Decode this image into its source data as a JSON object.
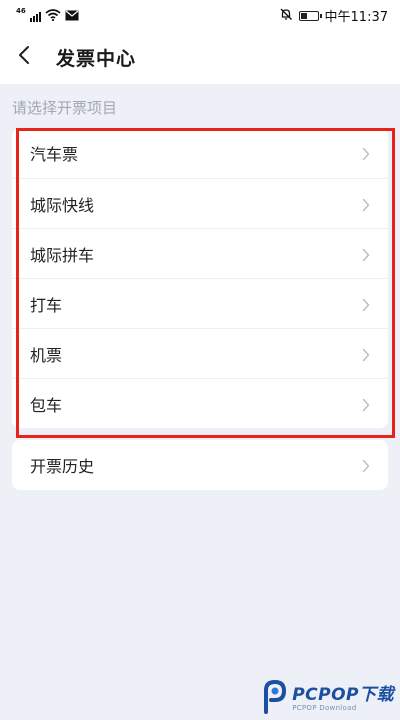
{
  "status_bar": {
    "network_label": "46",
    "time": "中午11:37"
  },
  "header": {
    "title": "发票中心"
  },
  "section_label": "请选择开票项目",
  "items": [
    {
      "label": "汽车票"
    },
    {
      "label": "城际快线"
    },
    {
      "label": "城际拼车"
    },
    {
      "label": "打车"
    },
    {
      "label": "机票"
    },
    {
      "label": "包车"
    }
  ],
  "history": {
    "label": "开票历史"
  },
  "watermark": {
    "brand": "PCPOP下载",
    "sub": "PCPOP Download"
  },
  "colors": {
    "highlight": "#e8231b",
    "page_bg": "#eef0f7",
    "watermark": "#1c4fa0"
  },
  "icons": {
    "back": "chevron-left-icon",
    "row_arrow": "chevron-right-icon",
    "battery": "battery-icon",
    "wifi": "wifi-icon",
    "mute": "bell-off-icon",
    "mail": "mail-icon"
  },
  "battery_level": 0.35
}
